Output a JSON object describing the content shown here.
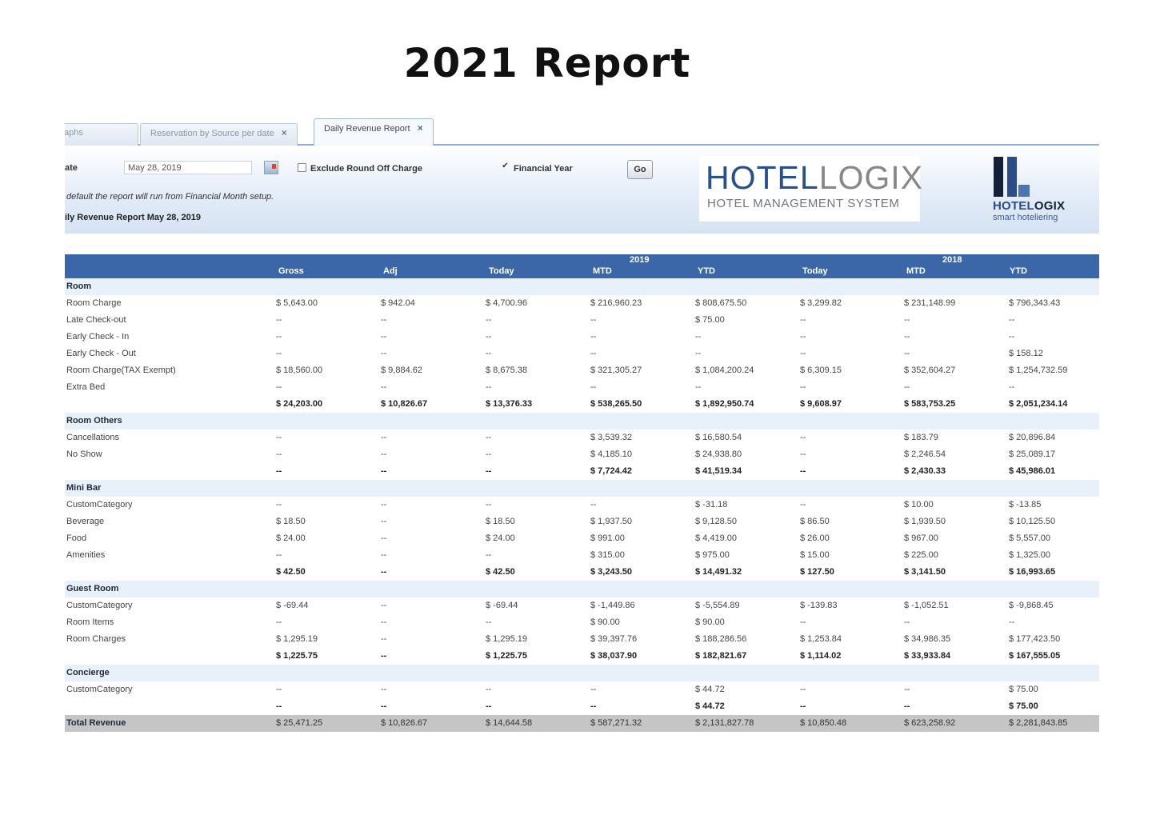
{
  "page_title": "2021 Report",
  "tabs": [
    {
      "label": "aphs",
      "closable": false
    },
    {
      "label": "Reservation by Source per date",
      "closable": true
    },
    {
      "label": "Daily Revenue Report",
      "closable": true,
      "active": true
    }
  ],
  "close_glyph": "×",
  "filters": {
    "date_label": "ate",
    "date_value": "May 28, 2019",
    "exclude_round_off_label": "Exclude Round Off Charge",
    "exclude_round_off_checked": false,
    "financial_year_label": "Financial Year",
    "financial_year_checked": true,
    "go_label": "Go",
    "note": "default the report will run from Financial Month setup.",
    "report_heading": "ily Revenue Report  May 28, 2019"
  },
  "logo": {
    "word_grey": "HOTEL",
    "word_blue": "OGIX",
    "word_l": "L",
    "subtitle": "HOTEL MANAGEMENT SYSTEM"
  },
  "brand": {
    "name_blue": "HOTEL",
    "name_dark": "OGIX",
    "tagline": "smart hoteliering"
  },
  "report": {
    "year_labels": [
      "2019",
      "2018"
    ],
    "columns": [
      "Gross",
      "Adj",
      "Today",
      "MTD",
      "YTD",
      "Today",
      "MTD",
      "YTD"
    ],
    "sections": [
      {
        "name": "Room",
        "rows": [
          {
            "label": "Room Charge",
            "values": [
              "$ 5,643.00",
              "$ 942.04",
              "$ 4,700.96",
              "$ 216,960.23",
              "$ 808,675.50",
              "$ 3,299.82",
              "$ 231,148.99",
              "$ 796,343.43"
            ]
          },
          {
            "label": "Late Check-out",
            "values": [
              "--",
              "--",
              "--",
              "--",
              "$ 75.00",
              "--",
              "--",
              "--"
            ]
          },
          {
            "label": "Early Check - In",
            "values": [
              "--",
              "--",
              "--",
              "--",
              "--",
              "--",
              "--",
              "--"
            ]
          },
          {
            "label": "Early Check - Out",
            "values": [
              "--",
              "--",
              "--",
              "--",
              "--",
              "--",
              "--",
              "$ 158.12"
            ]
          },
          {
            "label": "Room Charge(TAX Exempt)",
            "values": [
              "$ 18,560.00",
              "$ 9,884.62",
              "$ 8,675.38",
              "$ 321,305.27",
              "$ 1,084,200.24",
              "$ 6,309.15",
              "$ 352,604.27",
              "$ 1,254,732.59"
            ]
          },
          {
            "label": "Extra Bed",
            "values": [
              "--",
              "--",
              "--",
              "--",
              "--",
              "--",
              "--",
              "--"
            ]
          }
        ],
        "subtotal": [
          "$ 24,203.00",
          "$ 10,826.67",
          "$ 13,376.33",
          "$ 538,265.50",
          "$ 1,892,950.74",
          "$ 9,608.97",
          "$ 583,753.25",
          "$ 2,051,234.14"
        ]
      },
      {
        "name": "Room Others",
        "rows": [
          {
            "label": "Cancellations",
            "values": [
              "--",
              "--",
              "--",
              "$ 3,539.32",
              "$ 16,580.54",
              "--",
              "$ 183.79",
              "$ 20,896.84"
            ]
          },
          {
            "label": "No Show",
            "values": [
              "--",
              "--",
              "--",
              "$ 4,185.10",
              "$ 24,938.80",
              "--",
              "$ 2,246.54",
              "$ 25,089.17"
            ]
          }
        ],
        "subtotal": [
          "--",
          "--",
          "--",
          "$ 7,724.42",
          "$ 41,519.34",
          "--",
          "$ 2,430.33",
          "$ 45,986.01"
        ]
      },
      {
        "name": "Mini Bar",
        "rows": [
          {
            "label": "CustomCategory",
            "values": [
              "--",
              "--",
              "--",
              "--",
              "$ -31.18",
              "--",
              "$ 10.00",
              "$ -13.85"
            ]
          },
          {
            "label": "Beverage",
            "values": [
              "$ 18.50",
              "--",
              "$ 18.50",
              "$ 1,937.50",
              "$ 9,128.50",
              "$ 86.50",
              "$ 1,939.50",
              "$ 10,125.50"
            ]
          },
          {
            "label": "Food",
            "values": [
              "$ 24.00",
              "--",
              "$ 24.00",
              "$ 991.00",
              "$ 4,419.00",
              "$ 26.00",
              "$ 967.00",
              "$ 5,557.00"
            ]
          },
          {
            "label": "Amenities",
            "values": [
              "--",
              "--",
              "--",
              "$ 315.00",
              "$ 975.00",
              "$ 15.00",
              "$ 225.00",
              "$ 1,325.00"
            ]
          }
        ],
        "subtotal": [
          "$ 42.50",
          "--",
          "$ 42.50",
          "$ 3,243.50",
          "$ 14,491.32",
          "$ 127.50",
          "$ 3,141.50",
          "$ 16,993.65"
        ]
      },
      {
        "name": "Guest Room",
        "rows": [
          {
            "label": "CustomCategory",
            "values": [
              "$ -69.44",
              "--",
              "$ -69.44",
              "$ -1,449.86",
              "$ -5,554.89",
              "$ -139.83",
              "$ -1,052.51",
              "$ -9,868.45"
            ]
          },
          {
            "label": "Room Items",
            "values": [
              "--",
              "--",
              "--",
              "$ 90.00",
              "$ 90.00",
              "--",
              "--",
              "--"
            ]
          },
          {
            "label": "Room Charges",
            "values": [
              "$ 1,295.19",
              "--",
              "$ 1,295.19",
              "$ 39,397.76",
              "$ 188,286.56",
              "$ 1,253.84",
              "$ 34,986.35",
              "$ 177,423.50"
            ]
          }
        ],
        "subtotal": [
          "$ 1,225.75",
          "--",
          "$ 1,225.75",
          "$ 38,037.90",
          "$ 182,821.67",
          "$ 1,114.02",
          "$ 33,933.84",
          "$ 167,555.05"
        ]
      },
      {
        "name": "Concierge",
        "rows": [
          {
            "label": "CustomCategory",
            "values": [
              "--",
              "--",
              "--",
              "--",
              "$ 44.72",
              "--",
              "--",
              "$ 75.00"
            ]
          }
        ],
        "subtotal": [
          "--",
          "--",
          "--",
          "--",
          "$ 44.72",
          "--",
          "--",
          "$ 75.00"
        ]
      }
    ],
    "total_label": "Total Revenue",
    "total_values": [
      "$ 25,471.25",
      "$ 10,826.67",
      "$ 14,644.58",
      "$ 587,271.32",
      "$ 2,131,827.78",
      "$ 10,850.48",
      "$ 623,258.92",
      "$ 2,281,843.85"
    ]
  }
}
